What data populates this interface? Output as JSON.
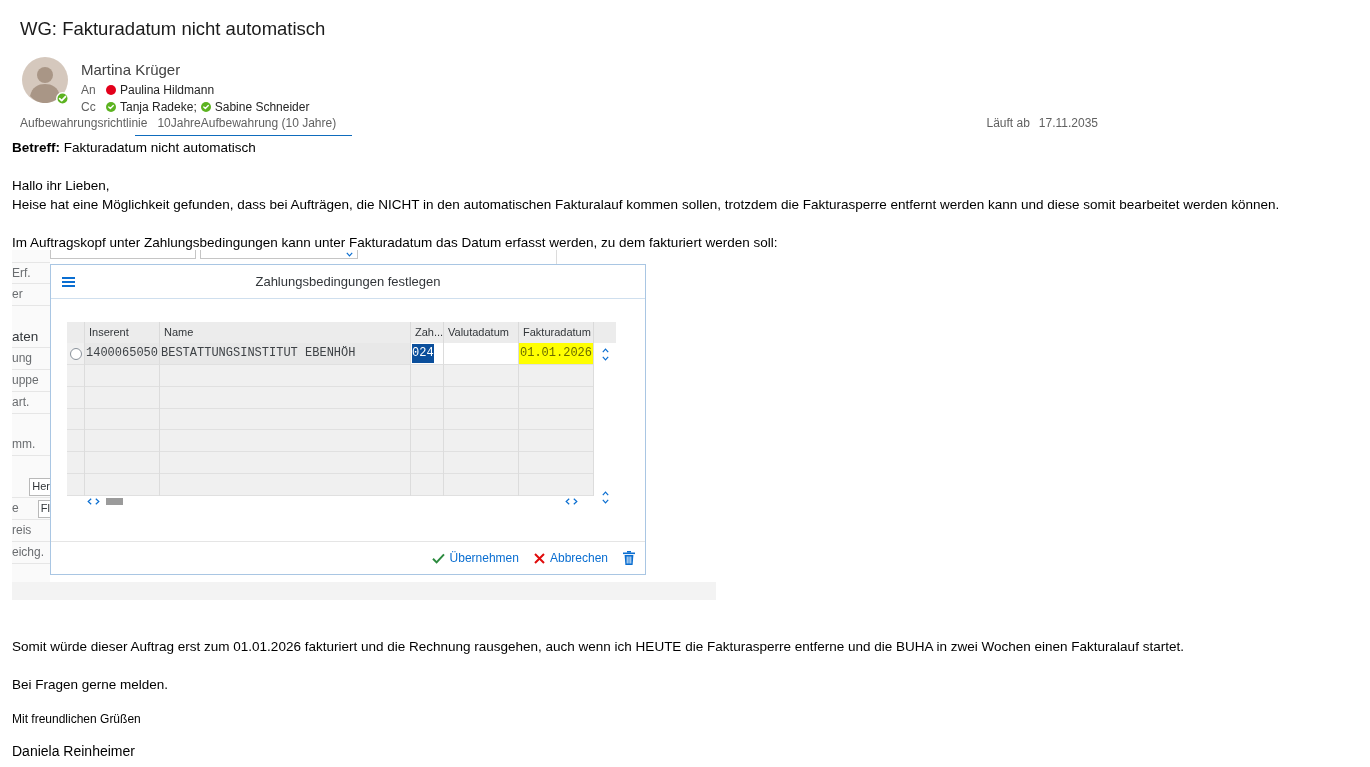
{
  "message": {
    "subject": "WG: Fakturadatum nicht automatisch",
    "sender": {
      "name": "Martina Krüger",
      "available": true
    },
    "to": {
      "label": "An",
      "recipients": [
        {
          "name": "Paulina Hildmann",
          "available": false
        }
      ]
    },
    "cc": {
      "label": "Cc",
      "recipients": [
        {
          "name": "Tanja Radeke;",
          "available": true
        },
        {
          "name": "Sabine Schneider",
          "available": true
        }
      ]
    },
    "retention": {
      "label": "Aufbewahrungsrichtlinie",
      "value": "10JahreAufbewahrung (10 Jahre)"
    },
    "expiry": {
      "label": "Läuft ab",
      "value": "17.11.2035"
    }
  },
  "body": {
    "paragraphs_before": [
      {
        "lines": [
          "**Betreff:** Fakturadatum nicht automatisch"
        ]
      },
      {
        "lines": [
          "Hallo ihr Lieben,",
          "Heise hat eine Möglichkeit gefunden, dass bei Aufträgen, die NICHT in den automatischen Fakturalauf kommen sollen, trotzdem die Fakturasperre entfernt werden kann und diese somit bearbeitet werden können."
        ]
      },
      {
        "lines": [
          "Im Auftragskopf unter Zahlungsbedingungen kann unter Fakturadatum das Datum erfasst werden, zu dem fakturiert werden soll:"
        ]
      }
    ],
    "screenshot": {
      "form_rows": [
        {
          "kind": "label",
          "text": "Erf."
        },
        {
          "kind": "label",
          "text": "er"
        },
        {
          "kind": "spacer"
        },
        {
          "kind": "heading",
          "text": "aten"
        },
        {
          "kind": "label",
          "text": "ung"
        },
        {
          "kind": "label",
          "text": "uppe"
        },
        {
          "kind": "label",
          "text": "art."
        },
        {
          "kind": "spacer"
        },
        {
          "kind": "label",
          "text": "mm."
        },
        {
          "kind": "spacer"
        },
        {
          "kind": "field",
          "value": "Her"
        },
        {
          "kind": "label_field",
          "text": "e",
          "value": "Fl"
        },
        {
          "kind": "label",
          "text": "reis"
        },
        {
          "kind": "label",
          "text": "eichg."
        }
      ],
      "dialog": {
        "title": "Zahlungsbedingungen festlegen",
        "table": {
          "columns": [
            "Inserent",
            "Name",
            "Zah...",
            "Valutadatum",
            "Fakturadatum"
          ],
          "rows": [
            {
              "selected": false,
              "cells": [
                {
                  "kind": "display",
                  "text": "1400065050",
                  "text_selected": false,
                  "highlighted": false
                },
                {
                  "kind": "display",
                  "text": "BESTATTUNGSINSTITUT EBENHÖH",
                  "text_selected": false,
                  "highlighted": false
                },
                {
                  "kind": "input",
                  "text": "024",
                  "text_selected": true,
                  "highlighted": false
                },
                {
                  "kind": "input",
                  "highlighted": false
                },
                {
                  "kind": "input",
                  "text": "01.01.2026",
                  "text_selected": false,
                  "highlighted": true
                }
              ]
            }
          ]
        },
        "buttons": [
          {
            "kind": "accept",
            "label": "Übernehmen"
          },
          {
            "kind": "cancel",
            "label": "Abbrechen"
          },
          {
            "kind": "delete"
          }
        ]
      }
    },
    "paragraphs_after": [
      {
        "lines": [
          "Somit würde dieser Auftrag erst zum 01.01.2026 fakturiert und die Rechnung rausgehen, auch wenn ich HEUTE die Fakturasperre entferne und die BUHA in zwei Wochen einen Fakturalauf startet."
        ]
      },
      {
        "lines": [
          "Bei Fragen gerne melden."
        ]
      }
    ],
    "signature": {
      "closing": "Mit freundlichen Grüßen",
      "name": "Daniela Reinheimer"
    }
  }
}
